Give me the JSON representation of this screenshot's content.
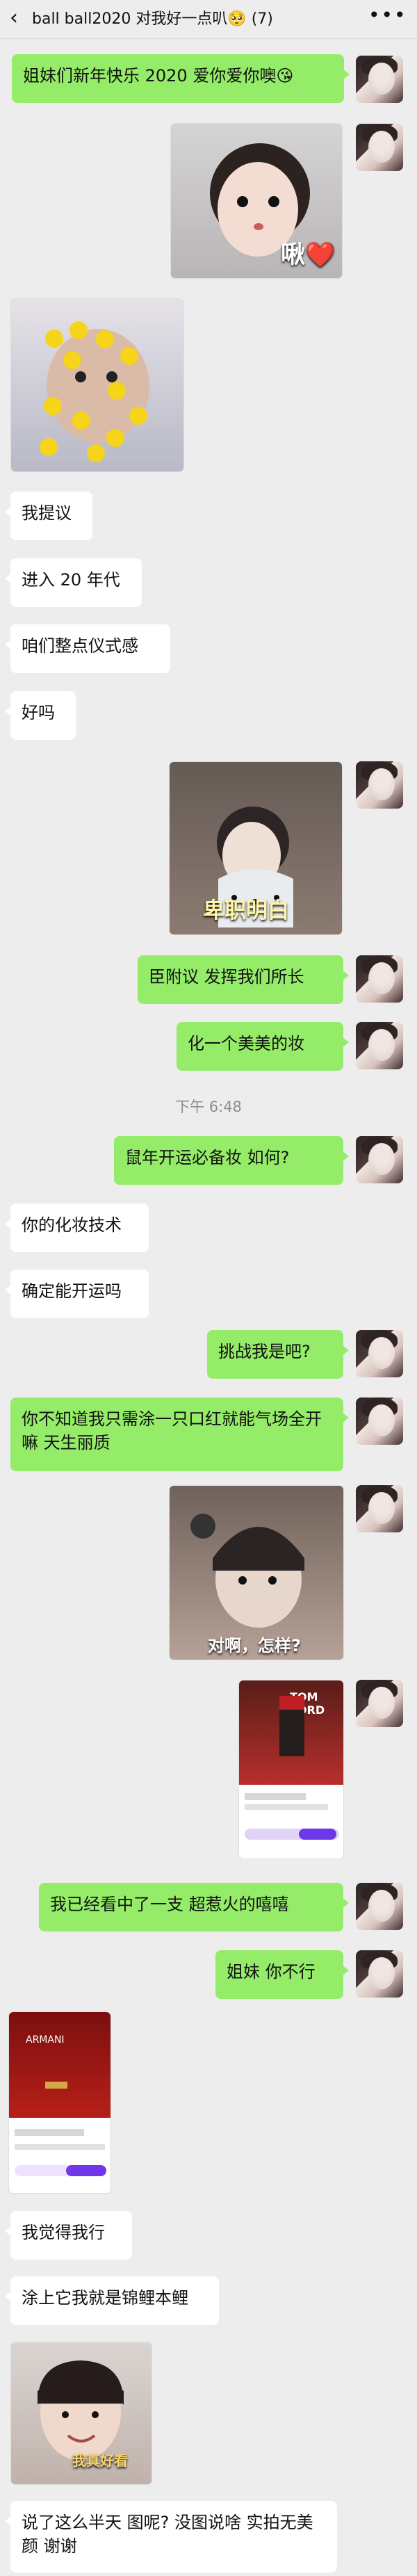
{
  "header": {
    "back_icon": "back-chevron-icon",
    "title": "ball ball2020 对我好一点叭🥺 (7)",
    "mute_icon": "bell-slash-icon",
    "more_icon": "ellipsis-icon"
  },
  "timestamp": "下午 6:48",
  "messages": {
    "m1": "姐妹们新年快乐 2020 爱你爱你噢😘",
    "m2_caption": "啾❤️",
    "m4": "我提议",
    "m5": "进入 20 年代",
    "m6": "咱们整点仪式感",
    "m7": "好吗",
    "m8_caption": "卑职明白",
    "m9": "臣附议 发挥我们所长",
    "m10": "化一个美美的妆",
    "m11": "鼠年开运必备妆 如何?",
    "m12": "你的化妆技术",
    "m13": "确定能开运吗",
    "m14": "挑战我是吧?",
    "m15": "你不知道我只需涂一只口红就能气场全开嘛 天生丽质",
    "m16_caption": "对啊，怎样?",
    "m17_brand": "TOM FORD",
    "m18": "我已经看中了一支 超惹火的嘻嘻",
    "m19": "姐妹 你不行",
    "m20_brand": "ARMANI",
    "m21": "我觉得我行",
    "m22": "涂上它我就是锦鲤本鲤",
    "m23_caption": "我真好看",
    "m24": "说了这么半天 图呢? 没图说啥 实拍无美颜 谢谢"
  },
  "colors": {
    "background": "#ededed",
    "me_bubble": "#95ec69",
    "other_bubble": "#ffffff",
    "timestamp": "#8d8d8d"
  }
}
